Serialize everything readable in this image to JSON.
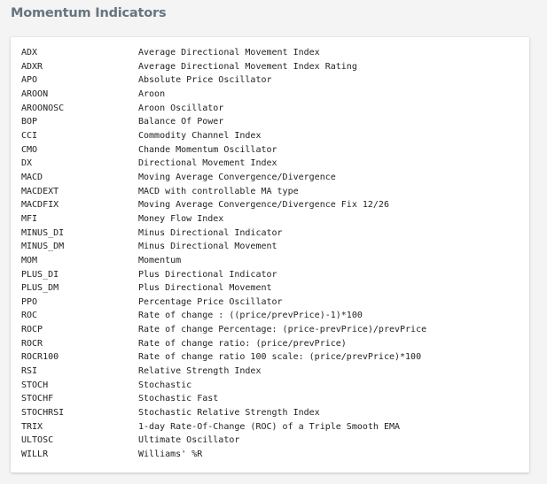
{
  "page": {
    "title": "Momentum Indicators"
  },
  "indicators": [
    {
      "abbr": "ADX",
      "name": "Average Directional Movement Index"
    },
    {
      "abbr": "ADXR",
      "name": "Average Directional Movement Index Rating"
    },
    {
      "abbr": "APO",
      "name": "Absolute Price Oscillator"
    },
    {
      "abbr": "AROON",
      "name": "Aroon"
    },
    {
      "abbr": "AROONOSC",
      "name": "Aroon Oscillator"
    },
    {
      "abbr": "BOP",
      "name": "Balance Of Power"
    },
    {
      "abbr": "CCI",
      "name": "Commodity Channel Index"
    },
    {
      "abbr": "CMO",
      "name": "Chande Momentum Oscillator"
    },
    {
      "abbr": "DX",
      "name": "Directional Movement Index"
    },
    {
      "abbr": "MACD",
      "name": "Moving Average Convergence/Divergence"
    },
    {
      "abbr": "MACDEXT",
      "name": "MACD with controllable MA type"
    },
    {
      "abbr": "MACDFIX",
      "name": "Moving Average Convergence/Divergence Fix 12/26"
    },
    {
      "abbr": "MFI",
      "name": "Money Flow Index"
    },
    {
      "abbr": "MINUS_DI",
      "name": "Minus Directional Indicator"
    },
    {
      "abbr": "MINUS_DM",
      "name": "Minus Directional Movement"
    },
    {
      "abbr": "MOM",
      "name": "Momentum"
    },
    {
      "abbr": "PLUS_DI",
      "name": "Plus Directional Indicator"
    },
    {
      "abbr": "PLUS_DM",
      "name": "Plus Directional Movement"
    },
    {
      "abbr": "PPO",
      "name": "Percentage Price Oscillator"
    },
    {
      "abbr": "ROC",
      "name": "Rate of change : ((price/prevPrice)-1)*100"
    },
    {
      "abbr": "ROCP",
      "name": "Rate of change Percentage: (price-prevPrice)/prevPrice"
    },
    {
      "abbr": "ROCR",
      "name": "Rate of change ratio: (price/prevPrice)"
    },
    {
      "abbr": "ROCR100",
      "name": "Rate of change ratio 100 scale: (price/prevPrice)*100"
    },
    {
      "abbr": "RSI",
      "name": "Relative Strength Index"
    },
    {
      "abbr": "STOCH",
      "name": "Stochastic"
    },
    {
      "abbr": "STOCHF",
      "name": "Stochastic Fast"
    },
    {
      "abbr": "STOCHRSI",
      "name": "Stochastic Relative Strength Index"
    },
    {
      "abbr": "TRIX",
      "name": "1-day Rate-Of-Change (ROC) of a Triple Smooth EMA"
    },
    {
      "abbr": "ULTOSC",
      "name": "Ultimate Oscillator"
    },
    {
      "abbr": "WILLR",
      "name": "Williams' %R"
    }
  ]
}
